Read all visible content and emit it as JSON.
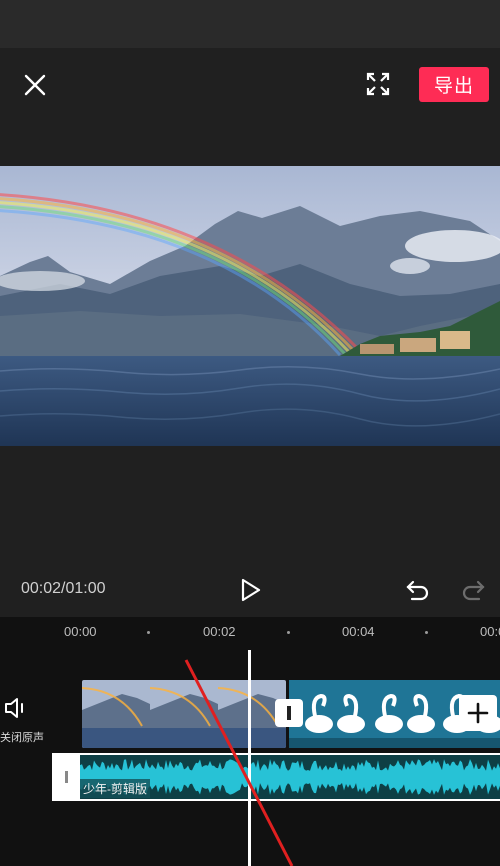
{
  "toolbar": {
    "export_label": "导出",
    "close_icon": "close-icon",
    "fullscreen_icon": "fullscreen-icon"
  },
  "player": {
    "time_readout": "00:02/01:00",
    "play_icon": "play-icon",
    "undo_icon": "undo-icon",
    "redo_icon": "redo-icon"
  },
  "timeline": {
    "ruler": [
      "00:00",
      "00:02",
      "00:04",
      "00:0"
    ],
    "mute_label": "关闭原声",
    "audio_label": "少年-剪辑版",
    "add_icon": "plus-icon"
  },
  "colors": {
    "accent": "#fe2c55",
    "audio_wave": "#27c2d6",
    "background": "#202020"
  }
}
